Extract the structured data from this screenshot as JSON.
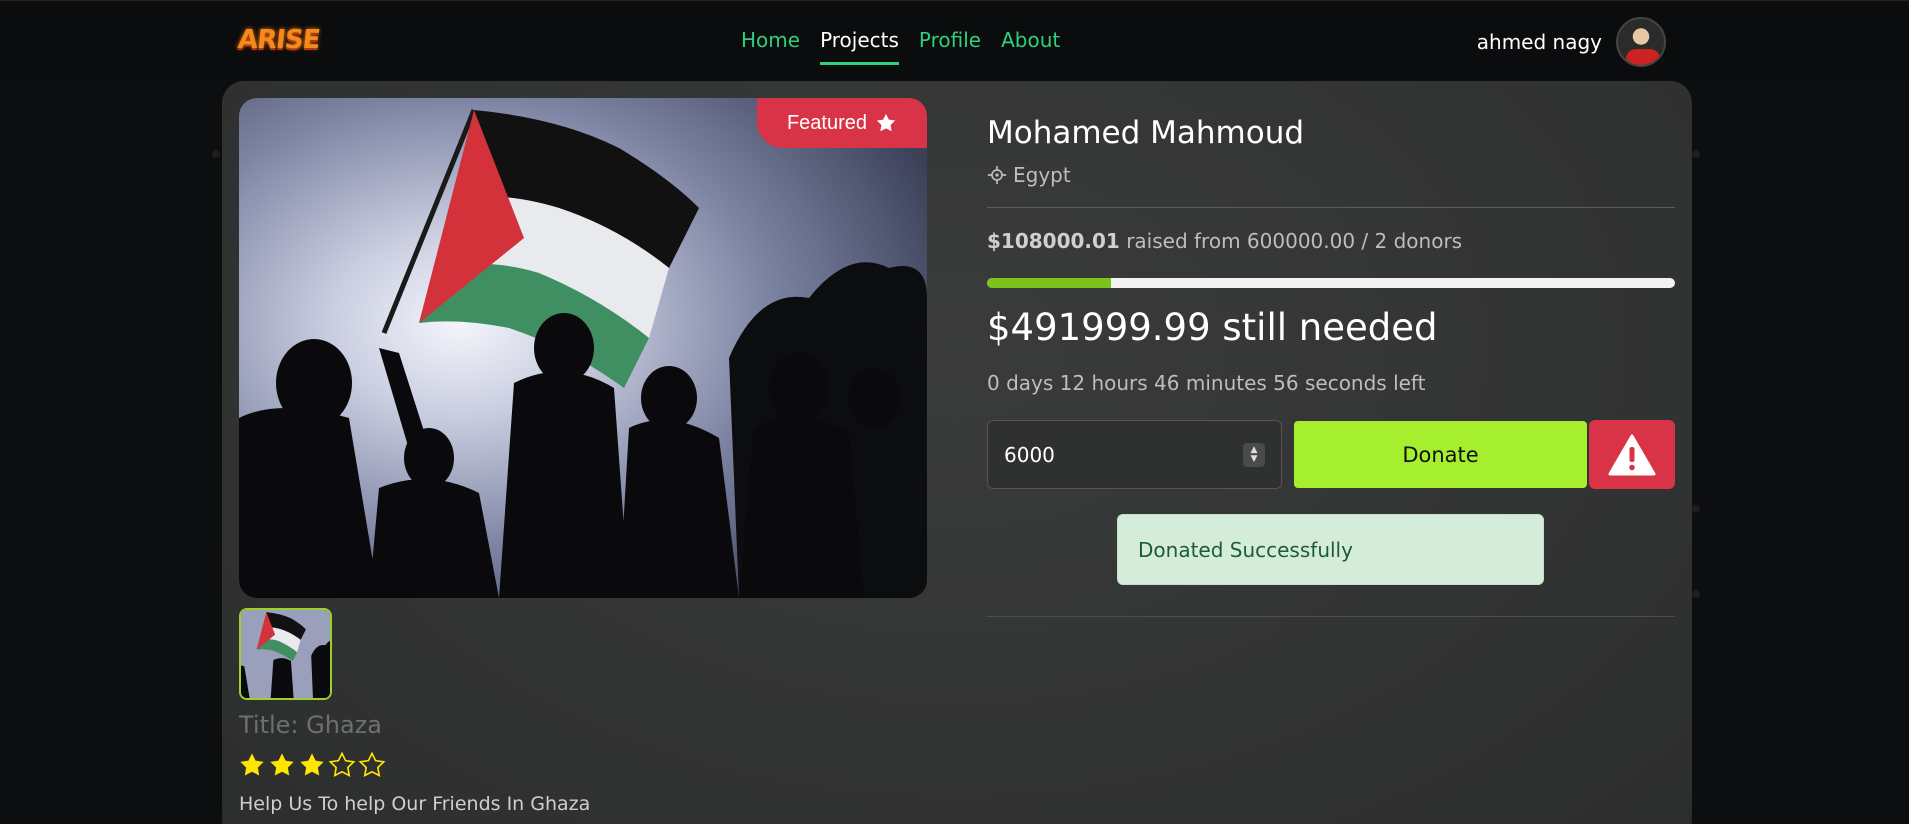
{
  "navbar": {
    "logo": "ARISE",
    "links": [
      {
        "label": "Home",
        "active": false
      },
      {
        "label": "Projects",
        "active": true
      },
      {
        "label": "Profile",
        "active": false
      },
      {
        "label": "About",
        "active": false
      }
    ],
    "user_name": "ahmed nagy",
    "accent_color": "#2fd07a"
  },
  "project": {
    "featured_label": "Featured",
    "title": "Title: Ghaza",
    "rating": 3,
    "rating_max": 5,
    "description": "Help Us To help Our Friends In Ghaza",
    "owner": "Mohamed Mahmoud",
    "location": "Egypt",
    "raised_amount": "$108000.01",
    "raised_text": "raised from 600000.00 / 2 donors",
    "progress_fraction": 0.18,
    "still_needed": "$491999.99 still needed",
    "time_left": "0 days 12 hours 46 minutes 56 seconds left",
    "donation_input_value": "6000",
    "donate_label": "Donate",
    "success_message": "Donated Successfully"
  },
  "colors": {
    "donate_button": "#a6ef2e",
    "featured_badge": "#d93347",
    "progress_fill": "#7cc41c",
    "star": "#ffe600"
  },
  "icons": [
    "star-icon",
    "location-crosshair-icon",
    "warning-triangle-icon",
    "stepper-arrows-icon"
  ]
}
